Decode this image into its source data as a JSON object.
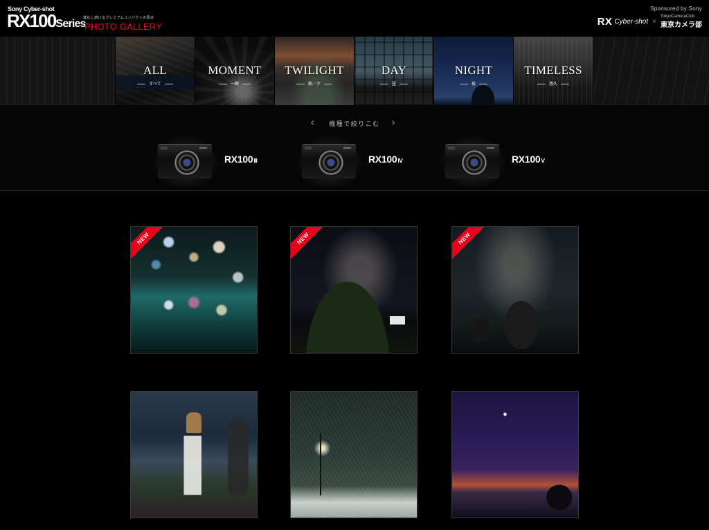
{
  "header": {
    "brand_small": "Sony Cyber-shot",
    "brand_main": "RX100",
    "brand_series": "Series",
    "tagline": "進化し続けるプレミアムコンパクトの原点",
    "subtitle": "PHOTO GALLERY",
    "sponsor_label": "Sponsored by Sony",
    "rx_logo": "RX",
    "cybershot_logo": "Cyber-shot",
    "separator": "×",
    "tcc_en": "TokyoCameraClub",
    "tcc_jp": "東京カメラ部"
  },
  "nav": {
    "active": "NIGHT",
    "items": [
      {
        "label": "ALL",
        "sub": "すべて"
      },
      {
        "label": "MOMENT",
        "sub": "一瞬"
      },
      {
        "label": "TWILIGHT",
        "sub": "朝／夕"
      },
      {
        "label": "DAY",
        "sub": "昼"
      },
      {
        "label": "NIGHT",
        "sub": "夜"
      },
      {
        "label": "TIMELESS",
        "sub": "悠久"
      }
    ]
  },
  "filter": {
    "title": "機種で絞りこむ",
    "prev_icon": "chevron-left-icon",
    "next_icon": "chevron-right-icon",
    "cameras": [
      {
        "name": "RX100",
        "roman": "Ⅲ",
        "brand": "SONY"
      },
      {
        "name": "RX100",
        "roman": "Ⅳ",
        "brand": "SONY"
      },
      {
        "name": "RX100",
        "roman": "Ⅴ",
        "brand": "SONY"
      }
    ]
  },
  "gallery": {
    "badge_label": "NEW",
    "photos": [
      {
        "subject": "bokeh-water-night",
        "is_new": true
      },
      {
        "subject": "milky-way-cliff",
        "is_new": true
      },
      {
        "subject": "milky-way-rocks",
        "is_new": true
      },
      {
        "subject": "street-monk-night",
        "is_new": false
      },
      {
        "subject": "snow-park-night",
        "is_new": false
      },
      {
        "subject": "twilight-sea-star",
        "is_new": false
      }
    ]
  },
  "colors": {
    "accent_red": "#e8001c",
    "background": "#000000"
  }
}
